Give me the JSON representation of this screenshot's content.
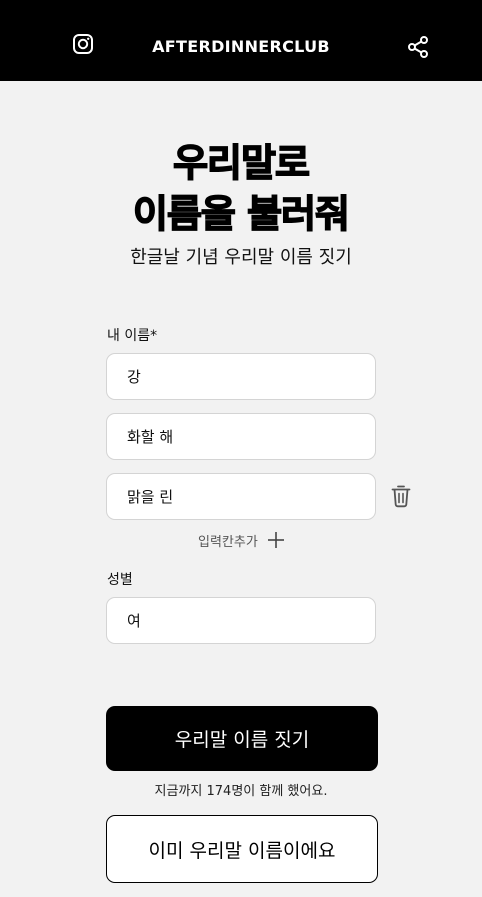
{
  "header": {
    "brand": "AFTERDINNERCLUB",
    "left_icon": "instagram-icon",
    "right_icon": "share-icon"
  },
  "hero": {
    "title_line1": "우리말로",
    "title_line2": "이름을 불러줘",
    "subtitle": "한글날 기념 우리말 이름 짓기"
  },
  "form": {
    "name_label": "내 이름*",
    "name_fields": [
      "강",
      "화할 해",
      "맑을 린"
    ],
    "delete_icon": "trash-icon",
    "add_field_label": "입력칸추가",
    "add_icon": "plus-icon",
    "gender_label": "성별",
    "gender_value": "여"
  },
  "actions": {
    "primary_label": "우리말 이름 짓기",
    "count_text": "지금까지 174명이 함께 했어요.",
    "secondary_label": "이미 우리말 이름이에요"
  },
  "colors": {
    "header_bg": "#000000",
    "page_bg": "#f2f2f2",
    "primary_bg": "#000000"
  }
}
